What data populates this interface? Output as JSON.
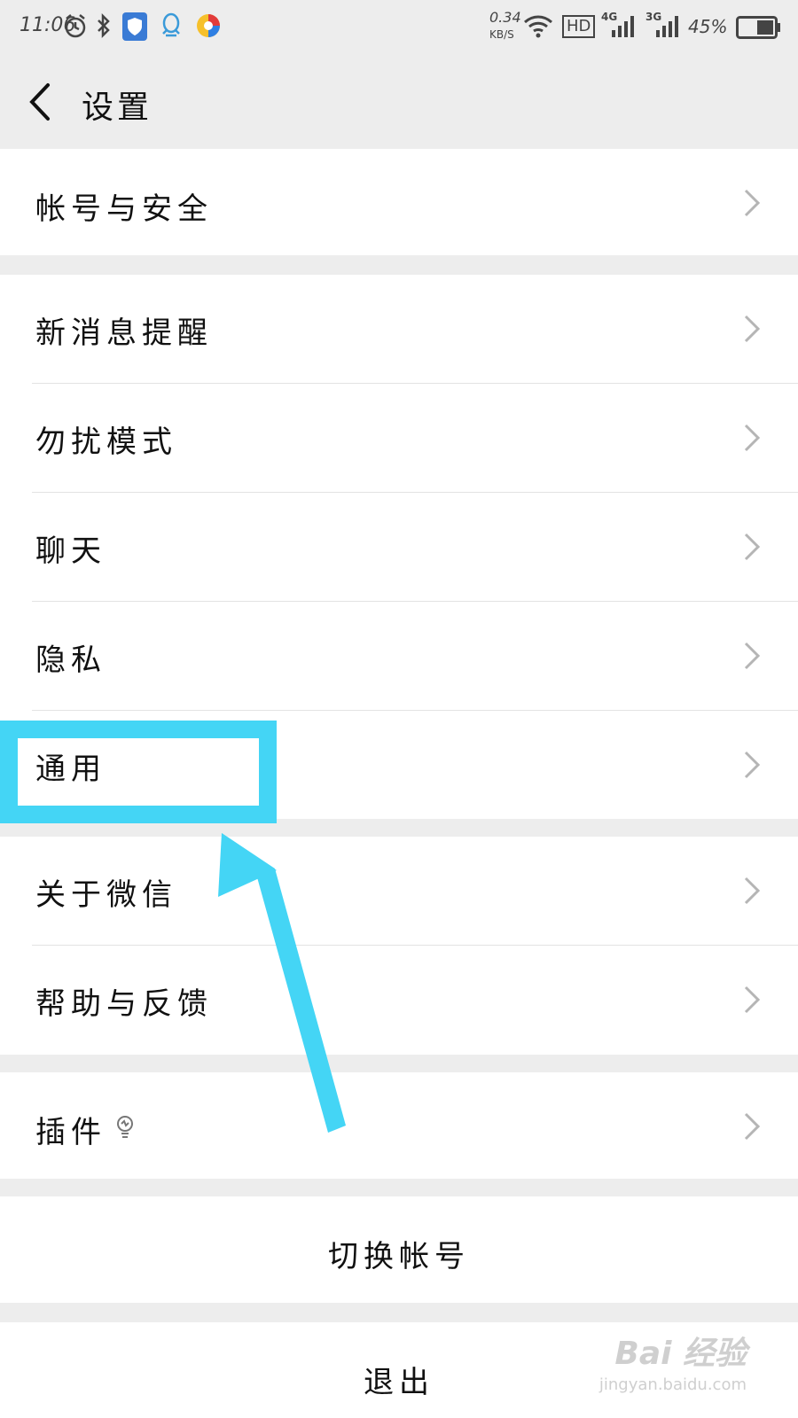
{
  "status_bar": {
    "time": "11:06",
    "net_speed": "0.34",
    "net_speed_unit": "KB/S",
    "hd": "HD",
    "sig1": "4G",
    "sig2": "3G",
    "battery": "45%",
    "icons": [
      "alarm-icon",
      "bluetooth-icon",
      "shield-icon",
      "qq-icon",
      "browser-icon",
      "wifi-icon",
      "battery-icon"
    ]
  },
  "header": {
    "title": "设置"
  },
  "items": {
    "account_security": "帐号与安全",
    "new_msg_alert": "新消息提醒",
    "dnd_mode": "勿扰模式",
    "chat": "聊天",
    "privacy": "隐私",
    "general": "通用",
    "about_wechat": "关于微信",
    "help_feedback": "帮助与反馈",
    "plugins": "插件"
  },
  "actions": {
    "switch_account": "切换帐号",
    "logout": "退出"
  },
  "watermark": {
    "logo": "Bai  经验",
    "url": "jingyan.baidu.com"
  },
  "colors": {
    "highlight": "#44d5f5",
    "background": "#ededed",
    "row": "#ffffff"
  }
}
